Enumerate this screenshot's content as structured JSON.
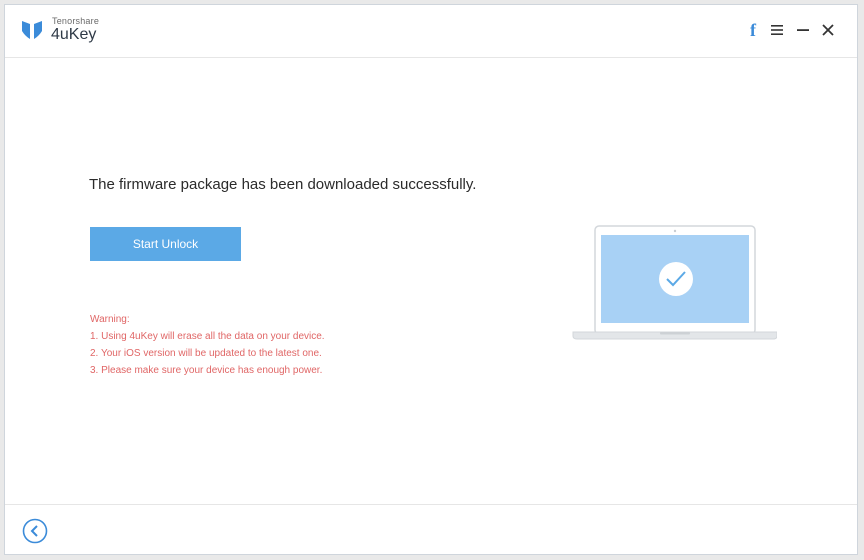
{
  "app": {
    "vendor": "Tenorshare",
    "name": "4uKey"
  },
  "titlebar": {
    "icons": [
      "facebook-icon",
      "menu-icon",
      "minimize-icon",
      "close-icon"
    ],
    "facebook_glyph": "f"
  },
  "main": {
    "headline": "The firmware package has been downloaded successfully.",
    "start_button_label": "Start Unlock",
    "warning": {
      "title": "Warning:",
      "items": [
        "1. Using 4uKey will erase all the data on your device.",
        "2. Your iOS version will be updated to the latest one.",
        "3. Please make sure your device has enough power."
      ]
    }
  },
  "colors": {
    "accent": "#5ba9e6",
    "warning": "#e06666",
    "screen": "#a8d1f5",
    "logo": "#3b8bd9"
  }
}
